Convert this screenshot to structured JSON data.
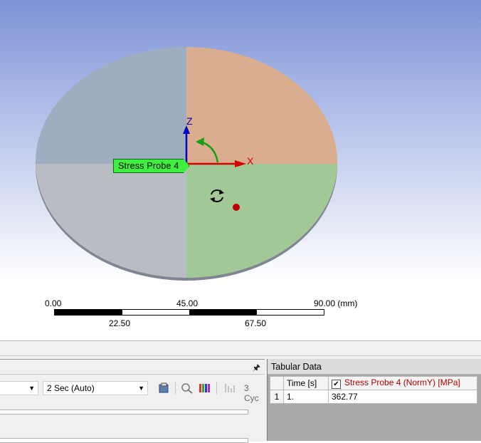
{
  "viewport": {
    "probe_label": "Stress Probe 4",
    "axes": {
      "x": "X",
      "z": "Z"
    },
    "colors": {
      "q_top_left": "#9fadc1",
      "q_top_right": "#dbad8f",
      "q_bottom_left": "#b9bcc3",
      "q_bottom_right": "#a3c898",
      "x_axis": "#d40000",
      "z_axis": "#0000c0",
      "rotation_arrow": "#14a014",
      "probe_point": "#c00000"
    },
    "scale": {
      "top_labels": [
        "0.00",
        "45.00",
        "90.00 (mm)"
      ],
      "bottom_labels": [
        "22.50",
        "67.50"
      ]
    }
  },
  "bottom_panel": {
    "left": {
      "time_step_option": "2 Sec (Auto)",
      "cycles_label": "3 Cyc"
    },
    "tabular": {
      "title": "Tabular Data",
      "columns": [
        "Time [s]",
        "Stress Probe 4 (NormY) [MPa]"
      ],
      "rows": [
        {
          "index": "1",
          "time": "1.",
          "value": "362.77"
        }
      ],
      "column_color": "#b00000"
    }
  }
}
